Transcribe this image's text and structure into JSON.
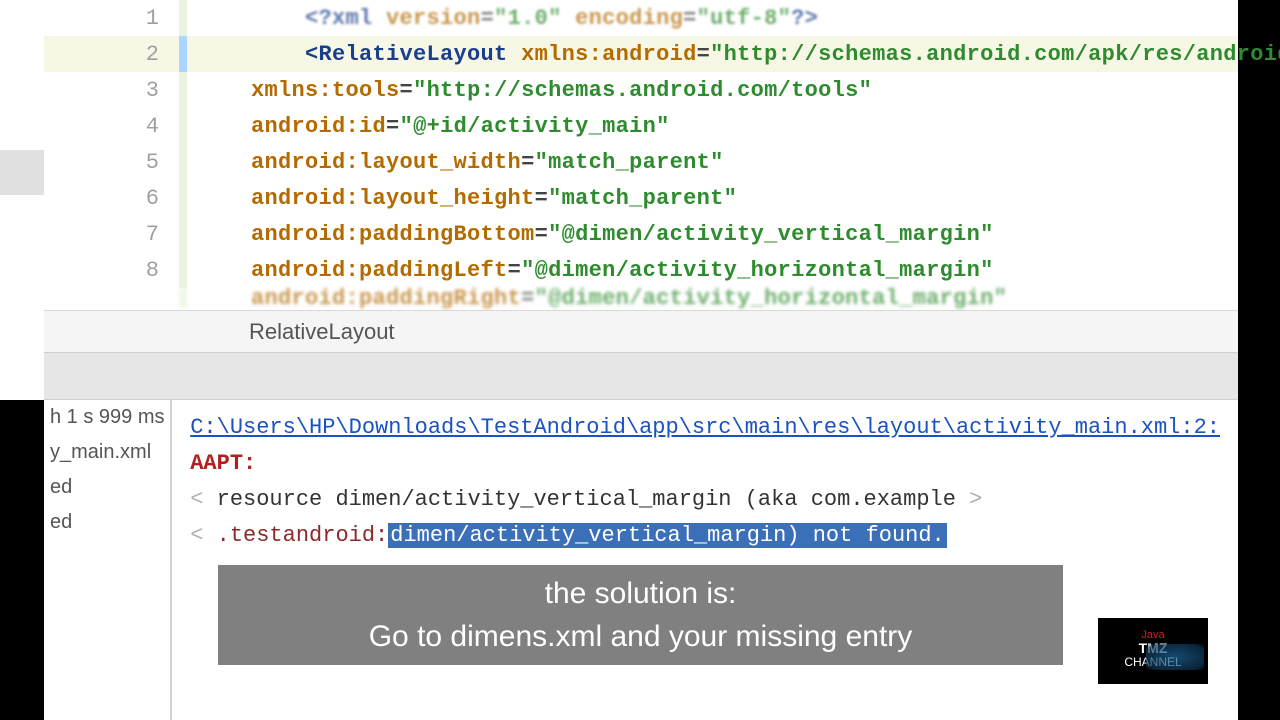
{
  "editor": {
    "lines": [
      {
        "num": "1"
      },
      {
        "num": "2"
      },
      {
        "num": "3"
      },
      {
        "num": "4"
      },
      {
        "num": "5"
      },
      {
        "num": "6"
      },
      {
        "num": "7"
      },
      {
        "num": "8"
      }
    ],
    "xml_decl_prefix": "<?xml ",
    "xml_version_attr": "version",
    "xml_version_val": "\"1.0\"",
    "xml_enc_attr": "encoding",
    "xml_enc_val": "\"utf-8\"",
    "xml_decl_suffix": "?>",
    "root_open": "<RelativeLayout ",
    "xmlns_android_attr": "xmlns:android",
    "xmlns_android_val": "\"http://schemas.android.com/apk/res/android\"",
    "xmlns_tools_attr": "xmlns:tools",
    "xmlns_tools_val": "\"http://schemas.android.com/tools\"",
    "id_attr": "android:id",
    "id_val": "\"@+id/activity_main\"",
    "lw_attr": "android:layout_width",
    "lw_val": "\"match_parent\"",
    "lh_attr": "android:layout_height",
    "lh_val": "\"match_parent\"",
    "pb_attr": "android:paddingBottom",
    "pb_val": "\"@dimen/activity_vertical_margin\"",
    "pl_attr": "android:paddingLeft",
    "pl_val": "\"@dimen/activity_horizontal_margin\"",
    "line9_attr": "android:paddingRight",
    "line9_val": "\"@dimen/activity_horizontal_margin\"",
    "eq": "="
  },
  "breadcrumb": "RelativeLayout",
  "build": {
    "time": "h 1 s 999 ms",
    "items": [
      "y_main.xml",
      "ed",
      "ed"
    ]
  },
  "error": {
    "path": "C:\\Users\\HP\\Downloads\\TestAndroid\\app\\src\\main\\res\\layout\\activity_main.xml:2:",
    "label": "AAPT:",
    "l1a": "resource dimen/activity_vertical_margin (aka com.example",
    "l2a": ".testandroid:",
    "l2sel": "dimen/activity_vertical_margin) not found."
  },
  "caption": {
    "l1": "the solution is:",
    "l2": "Go to dimens.xml and your missing entry"
  },
  "logo": {
    "top": "Java",
    "mid": "TMZ",
    "bot": "CHANNEL"
  }
}
